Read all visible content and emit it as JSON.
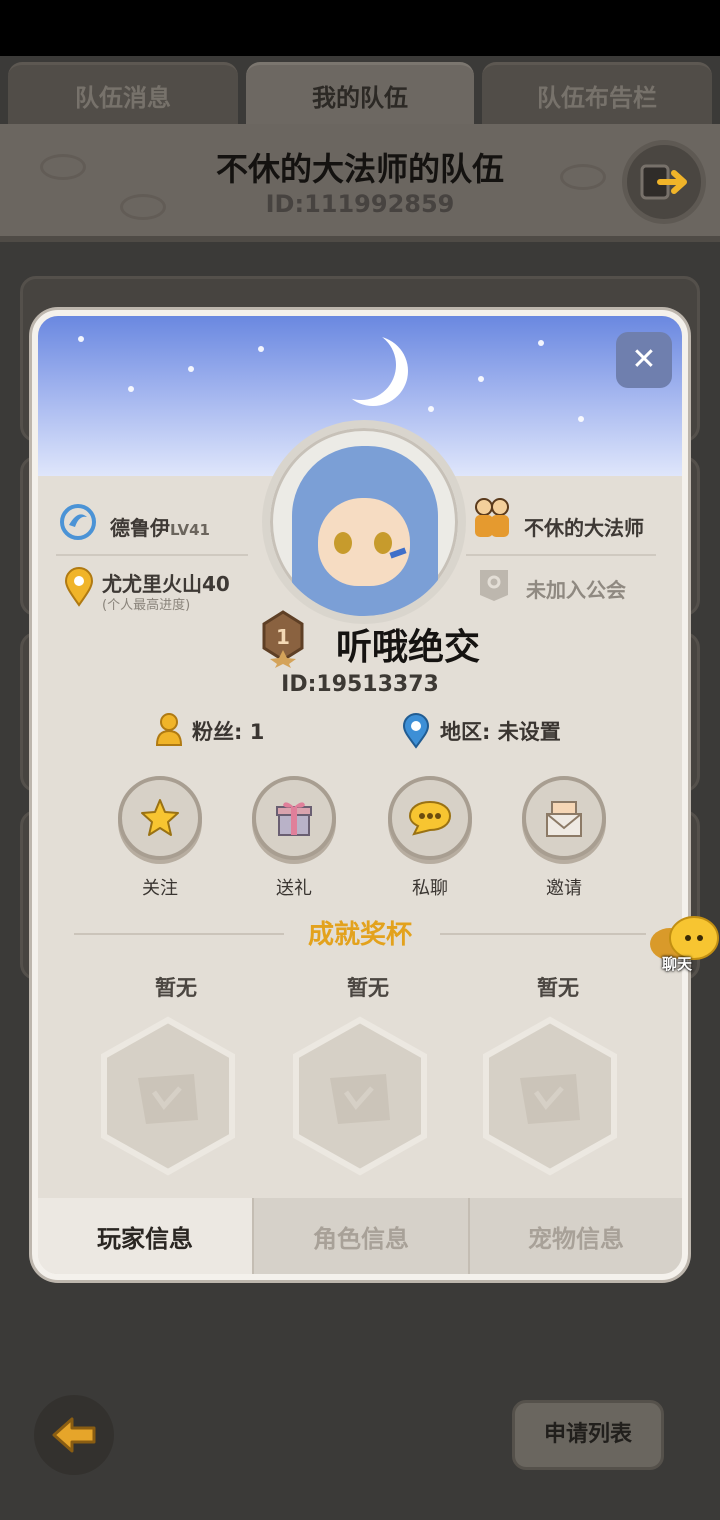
{
  "top_tabs": [
    {
      "label": "队伍消息",
      "active": false
    },
    {
      "label": "我的队伍",
      "active": true
    },
    {
      "label": "队伍布告栏",
      "active": false
    }
  ],
  "team": {
    "name": "不休的大法师的队伍",
    "id": "ID:111992859"
  },
  "profile": {
    "class_name": "德鲁伊",
    "level": "LV41",
    "progress_location": "尤尤里火山40",
    "progress_note": "(个人最高进度)",
    "team_owner": "不休的大法师",
    "guild": "未加入公会",
    "player_name": "听哦绝交",
    "player_id": "ID:19513373",
    "fans": "粉丝: 1",
    "region": "地区: 未设置"
  },
  "actions": [
    {
      "label": "关注",
      "icon": "star-icon"
    },
    {
      "label": "送礼",
      "icon": "gift-icon"
    },
    {
      "label": "私聊",
      "icon": "chat-bubble-icon"
    },
    {
      "label": "邀请",
      "icon": "envelope-icon"
    }
  ],
  "achievements": {
    "title": "成就奖杯",
    "slots": [
      "暂无",
      "暂无",
      "暂无"
    ]
  },
  "bottom_tabs": [
    {
      "label": "玩家信息",
      "active": true
    },
    {
      "label": "角色信息",
      "active": false
    },
    {
      "label": "宠物信息",
      "active": false
    }
  ],
  "chat_float_label": "聊天",
  "apply_list_label": "申请列表",
  "colors": {
    "accent_gold": "#e3a21d",
    "modal_bg": "#e3ded6",
    "page_bg": "#3b3a38"
  }
}
